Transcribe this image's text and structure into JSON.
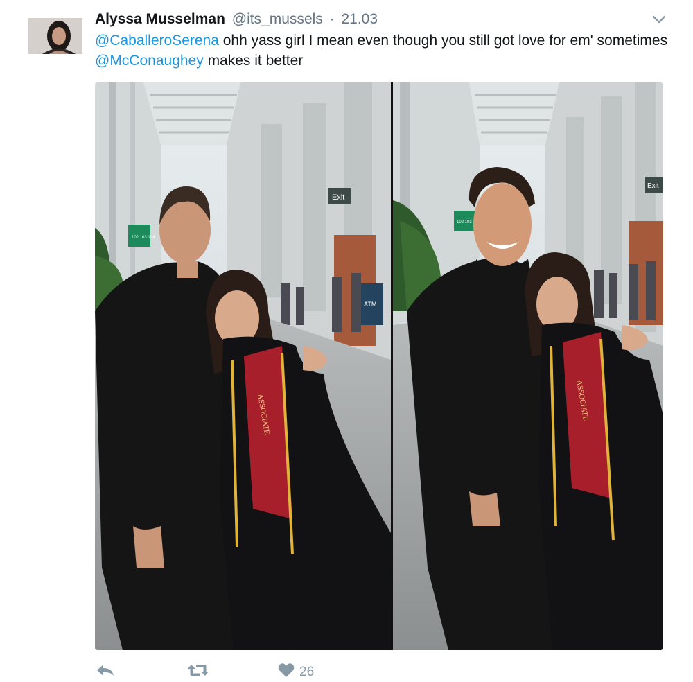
{
  "tweet": {
    "author": {
      "display_name": "Alyssa Musselman",
      "handle": "@its_mussels",
      "separator": "·",
      "timestamp": "21.03"
    },
    "text": {
      "mention_1": "@CaballeroSerena",
      "part_1": " ohh yass girl I mean even though you still got love for em' sometimes ",
      "mention_2": "@McConaughey",
      "part_2": " makes it better"
    },
    "media": {
      "left_photo": {
        "exit_sign": "Exit",
        "gate_sign": "102 103 104",
        "atm_sign": "ATM",
        "sash_text": "ASSOCIATE"
      },
      "right_photo": {
        "exit_sign": "Exit",
        "gate_sign": "102 103 104",
        "sash_text": "ASSOCIATE"
      }
    },
    "actions": {
      "reply_icon": "reply-icon",
      "retweet_icon": "retweet-icon",
      "like_icon": "heart-icon",
      "like_count": "26"
    },
    "colors": {
      "link": "#1b95e0",
      "meta": "#657786",
      "action": "#8899a6"
    }
  }
}
